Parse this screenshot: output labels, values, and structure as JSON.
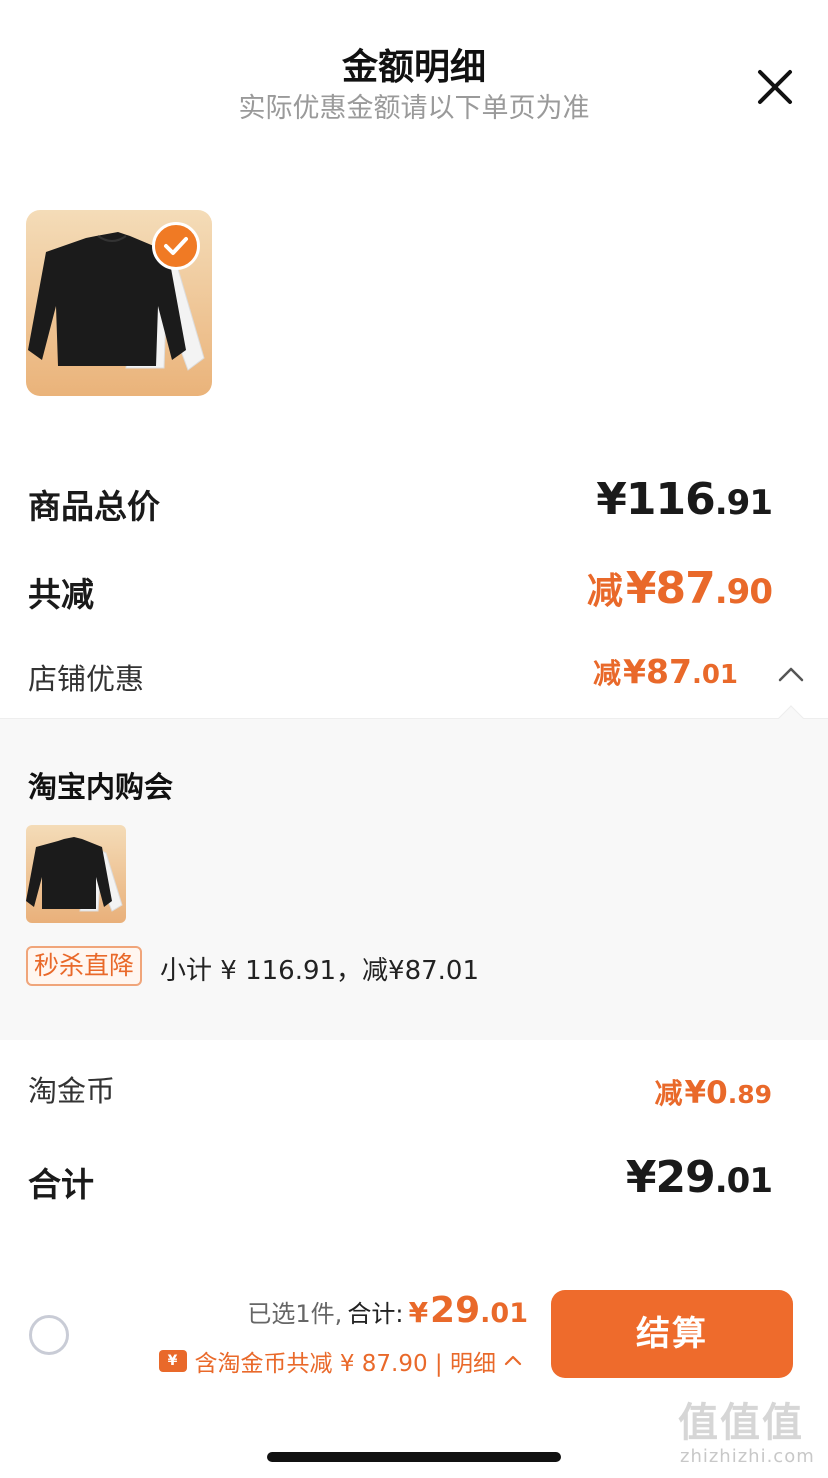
{
  "header": {
    "title": "金额明细",
    "subtitle": "实际优惠金额请以下单页为准"
  },
  "summary": {
    "goods_total_label": "商品总价",
    "goods_total_currency": "¥",
    "goods_total_int": "116",
    "goods_total_cents": ".91",
    "reduce_label": "共减",
    "reduce_prefix": "减",
    "reduce_currency": "¥",
    "reduce_int": "87",
    "reduce_cents": ".90",
    "shop_label": "店铺优惠",
    "shop_prefix": "减",
    "shop_currency": "¥",
    "shop_int": "87",
    "shop_cents": ".01"
  },
  "detail": {
    "title": "淘宝内购会",
    "promo_tag": "秒杀直降",
    "promo_text": "小计 ¥ 116.91，减¥87.01"
  },
  "coin": {
    "label": "淘金币",
    "prefix": "减",
    "currency": "¥",
    "int": "0",
    "cents": ".89"
  },
  "sum": {
    "label": "合计",
    "currency": "¥",
    "int": "29",
    "cents": ".01"
  },
  "bottom_bar": {
    "selected_text": "已选1件,",
    "total_label": "合计:",
    "currency": "¥",
    "amount_int": "29",
    "amount_cents": ".01",
    "coin_icon_text": "¥",
    "discount_text": "含淘金币共减 ¥ 87.90 | 明细",
    "checkout_label": "结算"
  },
  "watermark": {
    "logo": "值值值",
    "url": "zhizhizhi.com"
  },
  "colors": {
    "accent": "#ee6b2c",
    "discount": "#e9692a",
    "panel_bg": "#f8f8f8"
  },
  "icons": [
    "close-icon",
    "check-icon",
    "chevron-up-icon",
    "coin-icon",
    "radio-icon"
  ]
}
